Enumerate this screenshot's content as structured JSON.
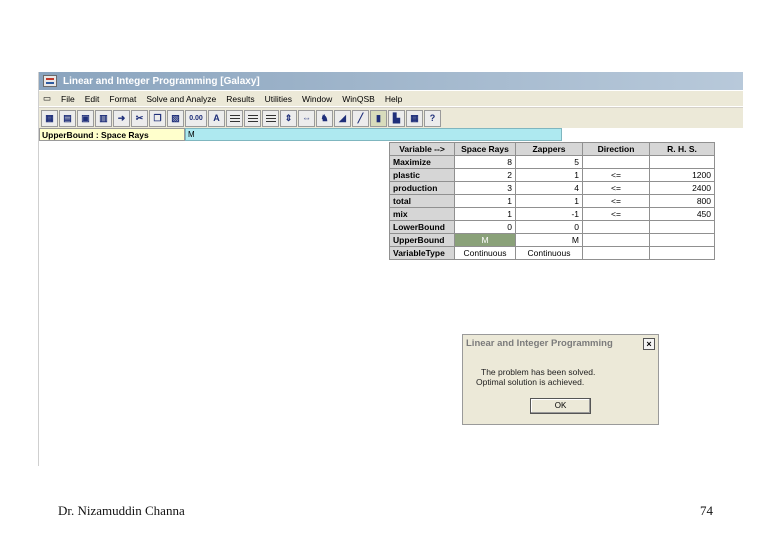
{
  "window": {
    "title": "Linear and Integer Programming   [Galaxy]"
  },
  "menu": [
    "File",
    "Edit",
    "Format",
    "Solve and Analyze",
    "Results",
    "Utilities",
    "Window",
    "WinQSB",
    "Help"
  ],
  "toolbar": {
    "buttons": [
      "calculator-icon",
      "open-icon",
      "save-icon",
      "print-icon",
      "exit-icon",
      "cut-icon",
      "copy-icon",
      "paste-icon",
      "number-format-button",
      "font-button",
      "align-left-button",
      "align-center-button",
      "align-right-button",
      "column-width-button",
      "row-height-button",
      "solve-button",
      "graph-button",
      "chart-button",
      "lindo-button",
      "summary-button",
      "grid-button",
      "help-button"
    ],
    "number_label": "0.00",
    "font_label": "A"
  },
  "cell_bar": {
    "ref": "UpperBound : Space Rays",
    "value": "M"
  },
  "grid": {
    "headers": [
      "Variable -->",
      "Space Rays",
      "Zappers",
      "Direction",
      "R. H. S."
    ],
    "rows": [
      [
        "Maximize",
        "8",
        "5",
        "",
        ""
      ],
      [
        "plastic",
        "2",
        "1",
        "<=",
        "1200"
      ],
      [
        "production",
        "3",
        "4",
        "<=",
        "2400"
      ],
      [
        "total",
        "1",
        "1",
        "<=",
        "800"
      ],
      [
        "mix",
        "1",
        "-1",
        "<=",
        "450"
      ],
      [
        "LowerBound",
        "0",
        "0",
        "",
        ""
      ],
      [
        "UpperBound",
        "M",
        "M",
        "",
        ""
      ],
      [
        "VariableType",
        "Continuous",
        "Continuous",
        "",
        ""
      ]
    ]
  },
  "dialog": {
    "title": "Linear and Integer Programming",
    "close": "×",
    "line1": "The problem has been solved.",
    "line2": "Optimal solution is achieved.",
    "ok": "OK"
  },
  "footer": {
    "author": "Dr. Nizamuddin Channa",
    "page": "74"
  }
}
